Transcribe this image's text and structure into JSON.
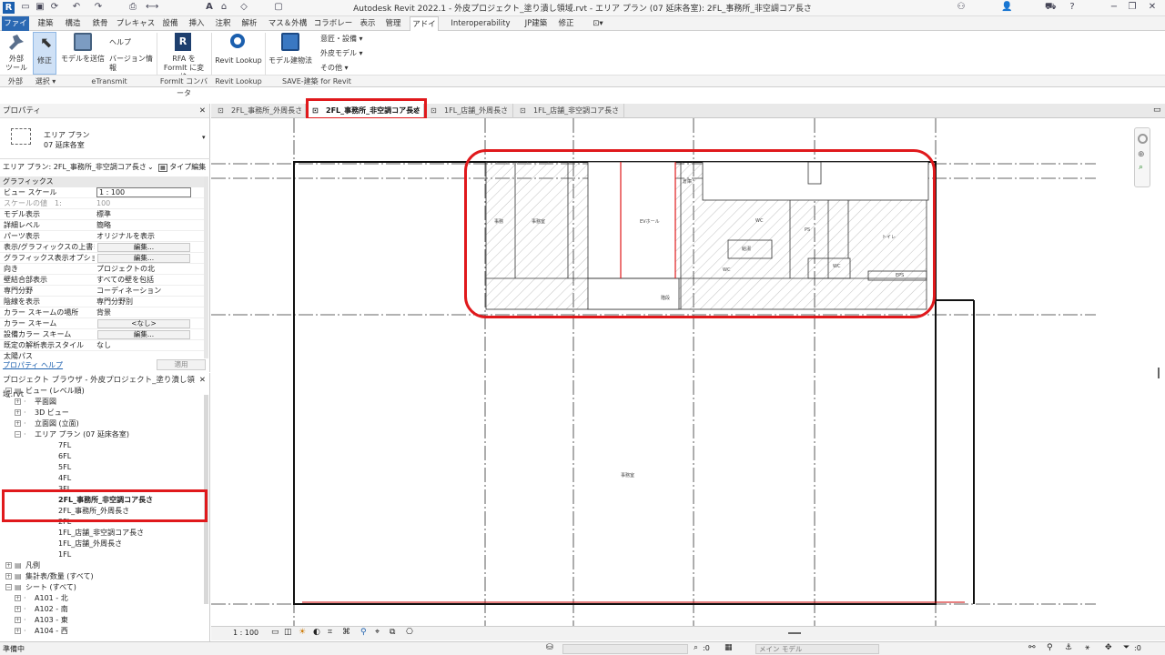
{
  "app": {
    "title": "Autodesk Revit 2022.1 - 外皮プロジェクト_塗り潰し領域.rvt - エリア プラン (07 延床各室): 2FL_事務所_非空調コア長さ"
  },
  "ribbon_tabs": [
    "ファイル",
    "建築",
    "構造",
    "鉄骨",
    "プレキャスト",
    "設備",
    "挿入",
    "注釈",
    "解析",
    "マス＆外構",
    "コラボレート",
    "表示",
    "管理",
    "アドイン",
    "Interoperability Tools",
    "JP建築",
    "修正"
  ],
  "ribbon": {
    "buttons": {
      "external_tools": "外部\nツール",
      "modify": "修正",
      "send_model": "モデルを送信",
      "help": "ヘルプ",
      "version_info": "バージョン情報",
      "rfa_to_formit": "RFA を\nFormIt に変換",
      "revit_lookup": "Revit Lookup",
      "model_building": "モデル建物法",
      "design_settings": "意匠・設備 ▾",
      "envelope_model": "外皮モデル ▾",
      "others": "その他 ▾"
    },
    "panels": [
      "外部",
      "選択 ▾",
      "eTransmit",
      "FormIt コンバータ",
      "Revit Lookup",
      "SAVE-建築 for Revit"
    ]
  },
  "properties": {
    "title": "プロパティ",
    "type_line1": "エリア プラン",
    "type_line2": "07 延床各室",
    "selector": "エリア プラン: 2FL_事務所_非空調コア長さ",
    "edit_type": "タイプ編集",
    "section": "グラフィックス",
    "rows": [
      {
        "k": "ビュー スケール",
        "v": "1 : 100",
        "input": true
      },
      {
        "k": "スケールの値　1:",
        "v": "100",
        "dim": true
      },
      {
        "k": "モデル表示",
        "v": "標準"
      },
      {
        "k": "詳細レベル",
        "v": "簡略"
      },
      {
        "k": "パーツ表示",
        "v": "オリジナルを表示"
      },
      {
        "k": "表示/グラフィックスの上書き",
        "v": "編集...",
        "btn": true
      },
      {
        "k": "グラフィックス表示オプション",
        "v": "編集...",
        "btn": true
      },
      {
        "k": "向き",
        "v": "プロジェクトの北"
      },
      {
        "k": "壁結合部表示",
        "v": "すべての壁を包括"
      },
      {
        "k": "専門分野",
        "v": "コーディネーション"
      },
      {
        "k": "陰線を表示",
        "v": "専門分野別"
      },
      {
        "k": "カラー スキームの場所",
        "v": "背景"
      },
      {
        "k": "カラー スキーム",
        "v": "<なし>",
        "btn": true
      },
      {
        "k": "設備カラー スキーム",
        "v": "編集...",
        "btn": true
      },
      {
        "k": "既定の解析表示スタイル",
        "v": "なし"
      },
      {
        "k": "太陽パス",
        "v": ""
      }
    ],
    "help_link": "プロパティ ヘルプ",
    "apply": "適用"
  },
  "browser": {
    "title": "プロジェクト ブラウザ - 外皮プロジェクト_塗り潰し領域.rvt",
    "items": [
      {
        "label": "ビュー (レベル順)",
        "level": 0,
        "exp": "−"
      },
      {
        "label": "平面図",
        "level": 1,
        "exp": "+"
      },
      {
        "label": "3D ビュー",
        "level": 1,
        "exp": "+"
      },
      {
        "label": "立面図 (立面)",
        "level": 1,
        "exp": "+"
      },
      {
        "label": "エリア プラン (07 延床各室)",
        "level": 1,
        "exp": "−"
      },
      {
        "label": "7FL",
        "level": 2
      },
      {
        "label": "6FL",
        "level": 2
      },
      {
        "label": "5FL",
        "level": 2
      },
      {
        "label": "4FL",
        "level": 2
      },
      {
        "label": "3FL",
        "level": 2
      },
      {
        "label": "2FL_事務所_非空調コア長さ",
        "level": 2,
        "bold": true
      },
      {
        "label": "2FL_事務所_外周長さ",
        "level": 2
      },
      {
        "label": "2FL",
        "level": 2
      },
      {
        "label": "1FL_店舗_非空調コア長さ",
        "level": 2
      },
      {
        "label": "1FL_店舗_外周長さ",
        "level": 2
      },
      {
        "label": "1FL",
        "level": 2
      },
      {
        "label": "凡例",
        "level": 0,
        "exp": "+"
      },
      {
        "label": "集計表/数量 (すべて)",
        "level": 0,
        "exp": "+"
      },
      {
        "label": "シート (すべて)",
        "level": 0,
        "exp": "−"
      },
      {
        "label": "A101 - 北",
        "level": 1,
        "exp": "+"
      },
      {
        "label": "A102 - 南",
        "level": 1,
        "exp": "+"
      },
      {
        "label": "A103 - 東",
        "level": 1,
        "exp": "+"
      },
      {
        "label": "A104 - 西",
        "level": 1,
        "exp": "+"
      }
    ]
  },
  "doc_tabs": [
    {
      "label": "2FL_事務所_外周長さ",
      "active": false
    },
    {
      "label": "2FL_事務所_非空調コア長さ",
      "active": true,
      "close": "×"
    },
    {
      "label": "1FL_店舗_外周長さ",
      "active": false
    },
    {
      "label": "1FL_店舗_非空調コア長さ",
      "active": false
    }
  ],
  "canvas": {
    "room_labels": [
      "事務",
      "事務室",
      "EVホール",
      "倉庫",
      "WC",
      "PS",
      "給湯",
      "WC",
      "WC",
      "トイレ",
      "EPS",
      "階段",
      "事務室"
    ]
  },
  "viewbar": {
    "scale": "1 : 100"
  },
  "status": {
    "left": "準備中",
    "zero": ":0",
    "model": "メイン モデル",
    "colors": {
      "highlight": "#e0191c",
      "file_tab": "#2b69b3"
    }
  }
}
